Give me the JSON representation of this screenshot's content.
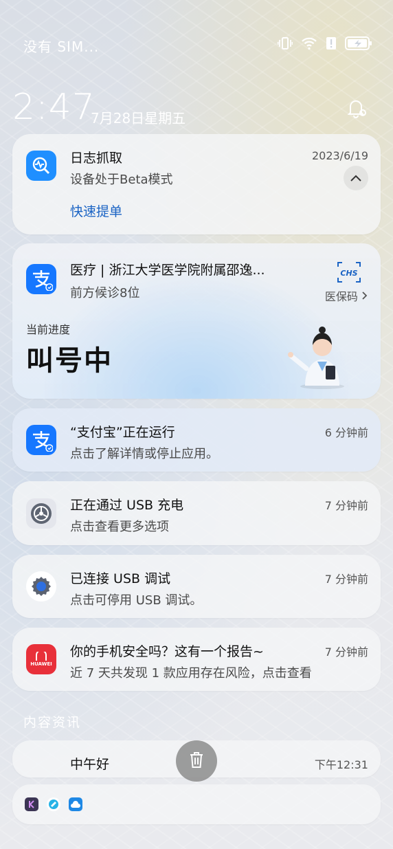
{
  "status_bar": {
    "carrier": "没有 SIM...",
    "icons": [
      "vibrate-icon",
      "wifi-icon",
      "alert-icon",
      "battery-charging-icon"
    ]
  },
  "lockscreen": {
    "time": "2:47",
    "date": "7月28日星期五",
    "notification_settings_icon": "bell-settings-icon"
  },
  "notifications": [
    {
      "id": "log",
      "app_icon": "log-capture-icon",
      "title": "日志抓取",
      "body": "设备处于Beta模式",
      "time": "2023/6/19",
      "action": "快速提单",
      "expanded": true
    },
    {
      "id": "medical",
      "app_icon": "alipay-icon",
      "title": "医疗 | 浙江大学医学院附属邵逸...",
      "body": "前方候诊8位",
      "badge": "CHS",
      "badge_label": "医保码",
      "progress_label": "当前进度",
      "progress_value": "叫号中"
    },
    {
      "id": "alipay-running",
      "app_icon": "alipay-icon",
      "title": "“支付宝”正在运行",
      "body": "点击了解详情或停止应用。",
      "time": "6 分钟前"
    },
    {
      "id": "usb-charge",
      "app_icon": "settings-system-icon",
      "title": "正在通过 USB 充电",
      "body": "点击查看更多选项",
      "time": "7 分钟前"
    },
    {
      "id": "usb-debug",
      "app_icon": "gear-icon",
      "title": "已连接 USB 调试",
      "body": "点击可停用 USB 调试。",
      "time": "7 分钟前"
    },
    {
      "id": "security",
      "app_icon": "huawei-icon",
      "app_icon_text": "HUAWEI",
      "title": "你的手机安全吗？这有一个报告~",
      "body": "近 7 天共发现 1 款应用存在风险，点击查看",
      "time": "7 分钟前"
    }
  ],
  "content_section": {
    "title": "内容资讯",
    "greeting": "中午好",
    "time": "下午12:31"
  },
  "collapsed_apps": [
    "k-app-icon",
    "browser-icon",
    "weather-icon"
  ],
  "colors": {
    "accent_blue": "#1a63c4",
    "alipay_blue": "#1677ff",
    "huawei_red": "#e8303a"
  }
}
